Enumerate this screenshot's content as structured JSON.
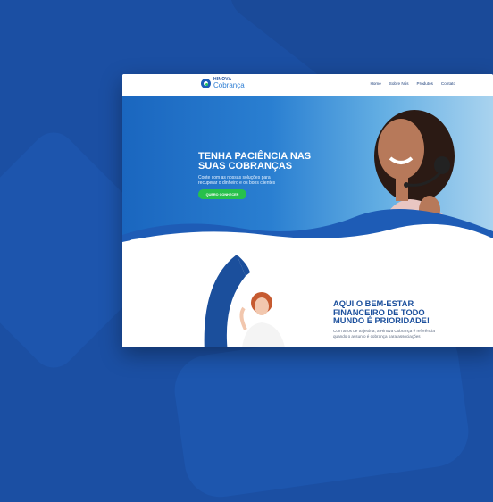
{
  "nav": {
    "logo_top": "HINOVA",
    "logo_bottom": "Cobrança",
    "items": [
      "Home",
      "Sobre Nós",
      "Produtos",
      "Contato"
    ]
  },
  "hero": {
    "title": "TENHA PACIÊNCIA NAS SUAS COBRANÇAS",
    "subtitle": "Conte com as nossas soluções para recuperar o dinheiro e os bons clientes",
    "button": "QUERO CONHECER"
  },
  "section2": {
    "title": "AQUI O BEM-ESTAR FINANCEIRO DE TODO MUNDO É PRIORIDADE!",
    "text": "Com anos de trajetória, a Hinova Cobrança é referência quando o assunto é cobrança para associações"
  },
  "colors": {
    "background": "#1b4fa3",
    "accent_green": "#27c04b",
    "brand_blue": "#1b4f9c"
  }
}
